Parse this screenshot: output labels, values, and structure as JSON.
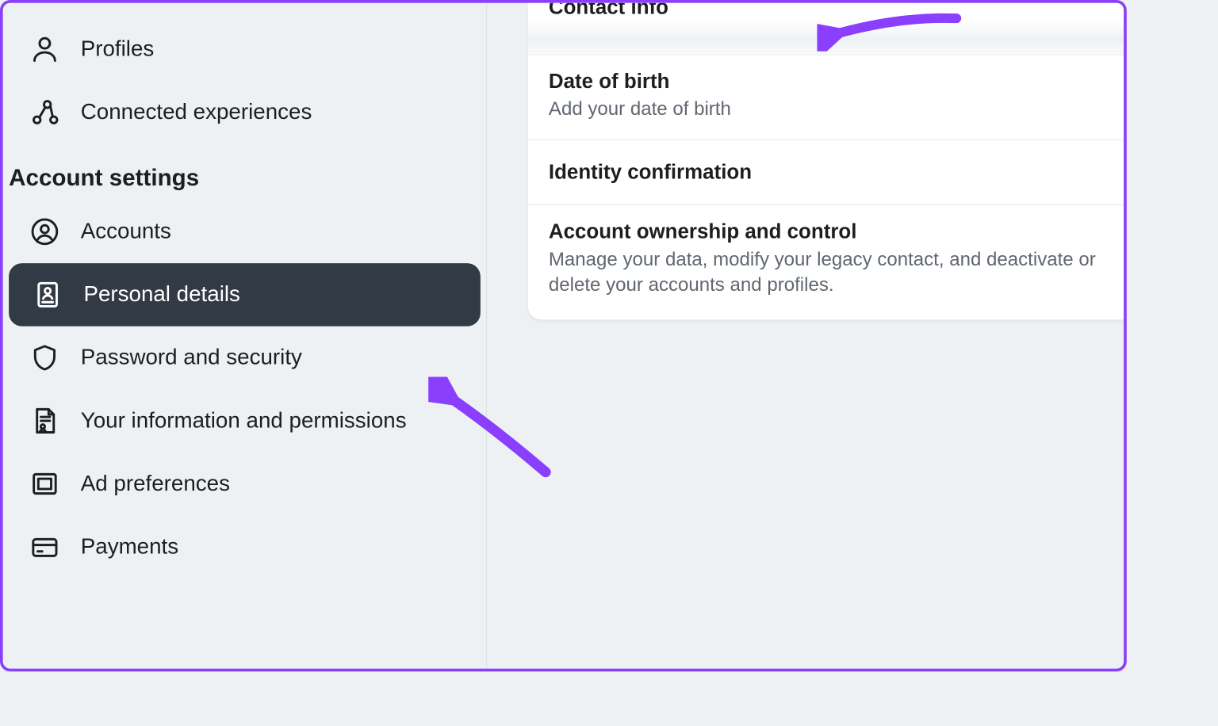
{
  "sidebar": {
    "top_items": [
      {
        "label": "Profiles"
      },
      {
        "label": "Connected experiences"
      }
    ],
    "section_label": "Account settings",
    "settings_items": [
      {
        "label": "Accounts"
      },
      {
        "label": "Personal details",
        "active": true
      },
      {
        "label": "Password and security"
      },
      {
        "label": "Your information and permissions"
      },
      {
        "label": "Ad preferences"
      },
      {
        "label": "Payments"
      }
    ]
  },
  "main": {
    "rows": [
      {
        "title": "Contact info",
        "sub": ""
      },
      {
        "title": "Date of birth",
        "sub": "Add your date of birth"
      },
      {
        "title": "Identity confirmation",
        "sub": ""
      },
      {
        "title": "Account ownership and control",
        "sub": "Manage your data, modify your legacy contact, and deactivate or delete your accounts and profiles."
      }
    ]
  },
  "annotation_color": "#8a3ffc"
}
